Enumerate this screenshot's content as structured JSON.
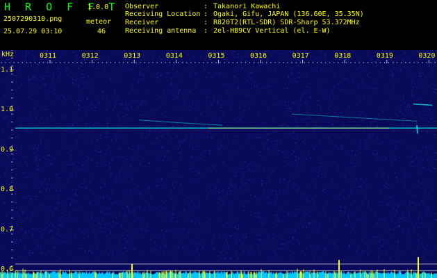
{
  "header": {
    "app_title": "H R O F F T",
    "app_version": "1.0.0",
    "file_name": "2507290310.png",
    "date_time": "25.07.29 03:10",
    "meteor_label": "meteor",
    "meteor_count": "46",
    "info": [
      {
        "label": "Observer",
        "value": "Takanori Kawachi"
      },
      {
        "label": "Receiving Location",
        "value": "Ogaki, Gifu, JAPAN (136.60E, 35.35N)"
      },
      {
        "label": "Receiver",
        "value": "R820T2(RTL-SDR) SDR-Sharp 53.372MHz"
      },
      {
        "label": "Receiving antenna",
        "value": "2el-HB9CV Vertical (el. E-W)"
      }
    ]
  },
  "chart_data": {
    "type": "heatmap",
    "y_unit": "kHz",
    "time_ticks": [
      "0311",
      "0312",
      "0313",
      "0314",
      "0315",
      "0316",
      "0317",
      "0318",
      "0319",
      "0320"
    ],
    "freq_ticks": [
      "1.1",
      "1.0",
      "0.9",
      "0.8",
      "0.7",
      "0.6"
    ],
    "ylim": [
      0.58,
      1.15
    ],
    "grid": true,
    "colors": {
      "background": "#0a0a5a",
      "dots": "#2a4ad0",
      "echo": "#00e5e5",
      "carrier": "#ffff44",
      "noise": "#00c8ff",
      "noise_peaks": "#ffff00",
      "grid": "#c8c8c8"
    }
  }
}
